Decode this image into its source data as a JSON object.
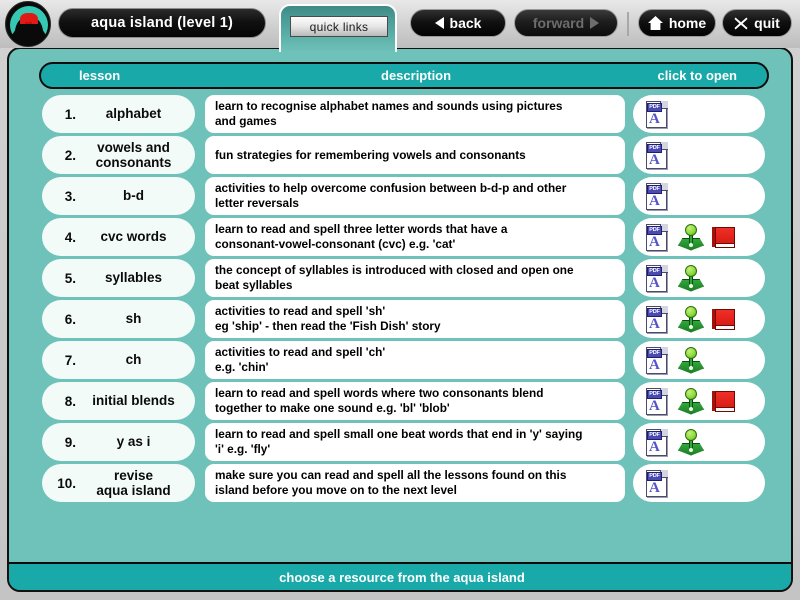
{
  "window": {
    "logo_icon": "volcano-island-logo",
    "title": "aqua island (level 1)"
  },
  "toolbar": {
    "quick_links_label": "quick links",
    "back_label": "back",
    "forward_label": "forward",
    "home_label": "home",
    "quit_label": "quit",
    "back_icon": "triangle-left-icon",
    "forward_icon": "triangle-right-icon",
    "home_icon": "house-icon",
    "quit_icon": "x-icon",
    "forward_disabled": true
  },
  "table": {
    "headers": {
      "lesson": "lesson",
      "description": "description",
      "open": "click to open"
    },
    "rows": [
      {
        "num": "1.",
        "lesson": "alphabet",
        "description": "learn to recognise alphabet names and sounds using pictures\nand games",
        "icons": [
          "pdf"
        ]
      },
      {
        "num": "2.",
        "lesson": "vowels and\nconsonants",
        "description": "fun strategies for remembering vowels and consonants",
        "icons": [
          "pdf"
        ]
      },
      {
        "num": "3.",
        "lesson": "b-d",
        "description": "activities to help overcome confusion between b-d-p and other\nletter reversals",
        "icons": [
          "pdf"
        ]
      },
      {
        "num": "4.",
        "lesson": "cvc words",
        "description": "learn to read and spell three letter words that have a\nconsonant-vowel-consonant (cvc) e.g. 'cat'",
        "icons": [
          "pdf",
          "joystick",
          "book"
        ]
      },
      {
        "num": "5.",
        "lesson": "syllables",
        "description": "the concept of syllables is introduced with closed and open one\nbeat syllables",
        "icons": [
          "pdf",
          "joystick"
        ]
      },
      {
        "num": "6.",
        "lesson": "sh",
        "description": "activities to read and spell 'sh'\neg 'ship' - then read the 'Fish Dish' story",
        "icons": [
          "pdf",
          "joystick",
          "book"
        ]
      },
      {
        "num": "7.",
        "lesson": "ch",
        "description": "activities to read and spell 'ch'\ne.g. 'chin'",
        "icons": [
          "pdf",
          "joystick"
        ]
      },
      {
        "num": "8.",
        "lesson": "initial blends",
        "description": "learn to read and spell words where two consonants blend\ntogether to make one sound e.g. 'bl' 'blob'",
        "icons": [
          "pdf",
          "joystick",
          "book"
        ]
      },
      {
        "num": "9.",
        "lesson": "y as i",
        "description": "learn to read and spell small one beat words that end in 'y' saying\n'i' e.g. 'fly'",
        "icons": [
          "pdf",
          "joystick"
        ]
      },
      {
        "num": "10.",
        "lesson": "revise\naqua island",
        "description": "make sure you can read and spell all the lessons found on this\nisland before you move on to the next level",
        "icons": [
          "pdf"
        ]
      }
    ]
  },
  "footer": {
    "message": "choose a resource from the aqua island"
  },
  "colors": {
    "panel_teal": "#6fc2b9",
    "bar_teal": "#19a9a9",
    "lesson_cell": "#f2fbf8",
    "desc_cell": "#ffffff",
    "button_black": "#111111"
  }
}
